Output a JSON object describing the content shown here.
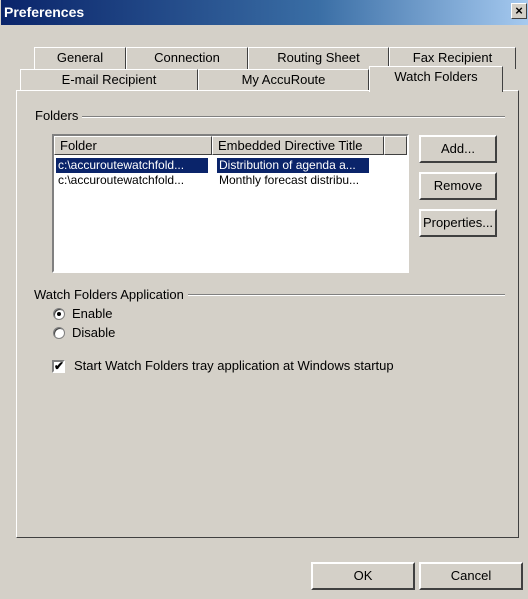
{
  "window": {
    "title": "Preferences",
    "close_glyph": "×"
  },
  "tabs": {
    "row1": [
      "General",
      "Connection",
      "Routing Sheet",
      "Fax Recipient"
    ],
    "row2": [
      "E-mail Recipient",
      "My AccuRoute",
      "Watch Folders"
    ],
    "active": "Watch Folders"
  },
  "folders_group": {
    "label": "Folders",
    "columns": [
      "Folder",
      "Embedded Directive Title"
    ],
    "rows": [
      {
        "folder": "c:\\accuroutewatchfold...",
        "title": "Distribution of agenda a...",
        "selected": true
      },
      {
        "folder": "c:\\accuroutewatchfold...",
        "title": "Monthly forecast distribu...",
        "selected": false
      }
    ],
    "buttons": {
      "add": "Add...",
      "remove": "Remove",
      "properties": "Properties..."
    }
  },
  "app_group": {
    "label": "Watch Folders Application",
    "enable": "Enable",
    "disable": "Disable",
    "selected": "Enable",
    "startup_checkbox": {
      "label": "Start Watch Folders tray application at Windows startup",
      "checked": true
    }
  },
  "footer": {
    "ok": "OK",
    "cancel": "Cancel"
  },
  "colors": {
    "face": "#d4d0c8",
    "title_start": "#0a246a",
    "title_end": "#a6caf0",
    "selection": "#0a246a"
  }
}
